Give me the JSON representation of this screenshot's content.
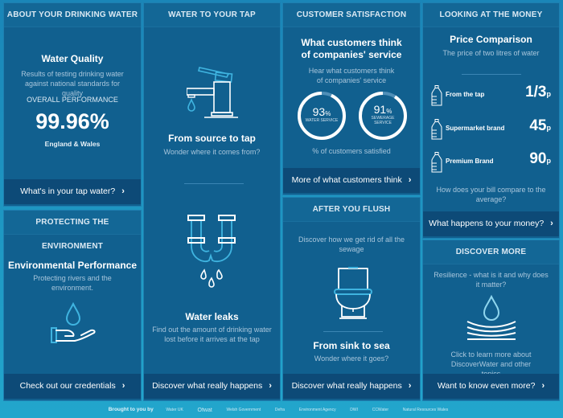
{
  "cards": {
    "drinking_water": {
      "header": "ABOUT YOUR DRINKING WATER",
      "title": "Water Quality",
      "subtitle": "Results of testing drinking water against national standards for quality",
      "metric_label": "OVERALL PERFORMANCE",
      "metric_value": "99.96%",
      "region": "England & Wales",
      "cta": "What's in your tap water?"
    },
    "environment": {
      "header": "PROTECTING THE ENVIRONMENT",
      "title": "Environmental Performance",
      "subtitle": "Protecting rivers and the environment.",
      "icon": "hand-water-drop-icon",
      "cta": "Check out our credentials"
    },
    "tap": {
      "header": "WATER TO YOUR TAP",
      "title1": "From source to tap",
      "subtitle1": "Wonder where it comes from?",
      "icon1": "tap-icon",
      "title2": "Water leaks",
      "subtitle2": "Find out the amount of drinking water lost before it arrives at the tap",
      "icon2": "leaking-pipe-icon",
      "cta": "Discover what really happens"
    },
    "satisfaction": {
      "header": "CUSTOMER SATISFACTION",
      "title": "What customers think of companies' service",
      "subtitle": "Hear what customers think of companies' service",
      "rings": [
        {
          "value": 93,
          "display": "93",
          "unit": "%",
          "label": "WATER SERVICE"
        },
        {
          "value": 91,
          "display": "91",
          "unit": "%",
          "label": "SEWERAGE SERVICE"
        }
      ],
      "caption": "% of customers satisfied",
      "cta": "More of what customers think"
    },
    "flush": {
      "header": "AFTER YOU FLUSH",
      "subtitle_top": "Discover how we get rid of all the sewage",
      "icon": "toilet-icon",
      "title": "From sink to sea",
      "subtitle": "Wonder where it goes?",
      "cta": "Discover what really happens"
    },
    "money": {
      "header": "LOOKING AT THE MONEY",
      "title": "Price Comparison",
      "subtitle": "The price of two litres of water",
      "prices": [
        {
          "label": "From the tap",
          "value": "1/3",
          "unit": "p"
        },
        {
          "label": "Supermarket brand",
          "value": "45",
          "unit": "p"
        },
        {
          "label": "Premium Brand",
          "value": "90",
          "unit": "p"
        }
      ],
      "question": "How does your bill compare to the average?",
      "cta": "What happens to your money?"
    },
    "discover": {
      "header": "DISCOVER MORE",
      "subtitle_top": "Resilience - what is it and why does it matter?",
      "icon": "water-resilience-icon",
      "body": "Click to learn more about DiscoverWater and other topics",
      "cta": "Want to know even more?"
    }
  },
  "footer": {
    "brought_by": "Brought to you by",
    "sponsors": [
      "Water UK",
      "Ofwat",
      "Welsh Government",
      "Defra",
      "Environment Agency",
      "DWI",
      "CCWater",
      "Natural Resources Wales"
    ]
  },
  "colors": {
    "page_bg": "#1a86b8",
    "card_bg": "#11608f",
    "footer_button_bg": "#0d4a77",
    "accent": "#3fb4e0"
  }
}
